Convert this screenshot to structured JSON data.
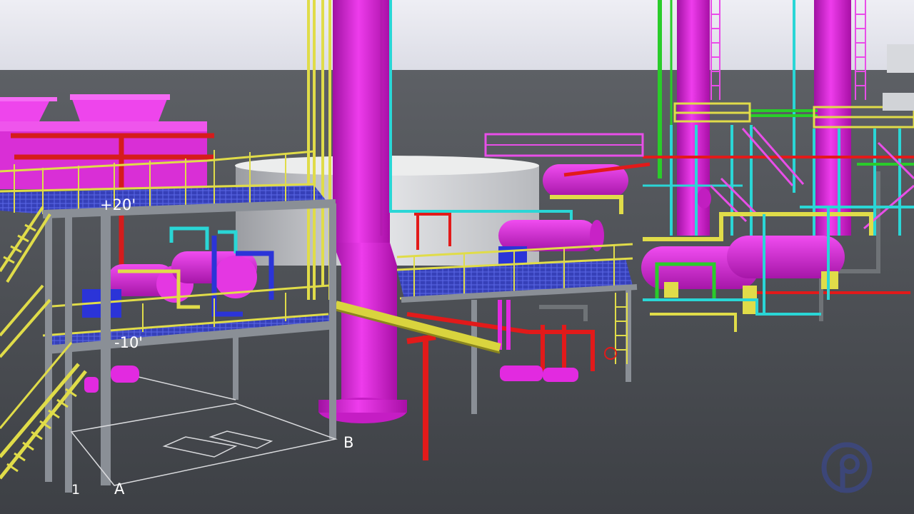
{
  "labels": {
    "elevation_upper": "+20'",
    "elevation_lower": "-10'",
    "grid_1": "1",
    "grid_a": "A",
    "grid_b": "B"
  },
  "colors": {
    "sky": "#e4e4ec",
    "ground": "#4a4d52",
    "steel": "#8a8f96",
    "structure": "#e0dc49",
    "equipment": "#e22ae0",
    "pipe_cyan": "#2ad6d6",
    "pipe_red": "#e21a1a",
    "pipe_green": "#2acc2a",
    "pipe_blue": "#2b34d8",
    "tank": "#cfd1d4"
  }
}
